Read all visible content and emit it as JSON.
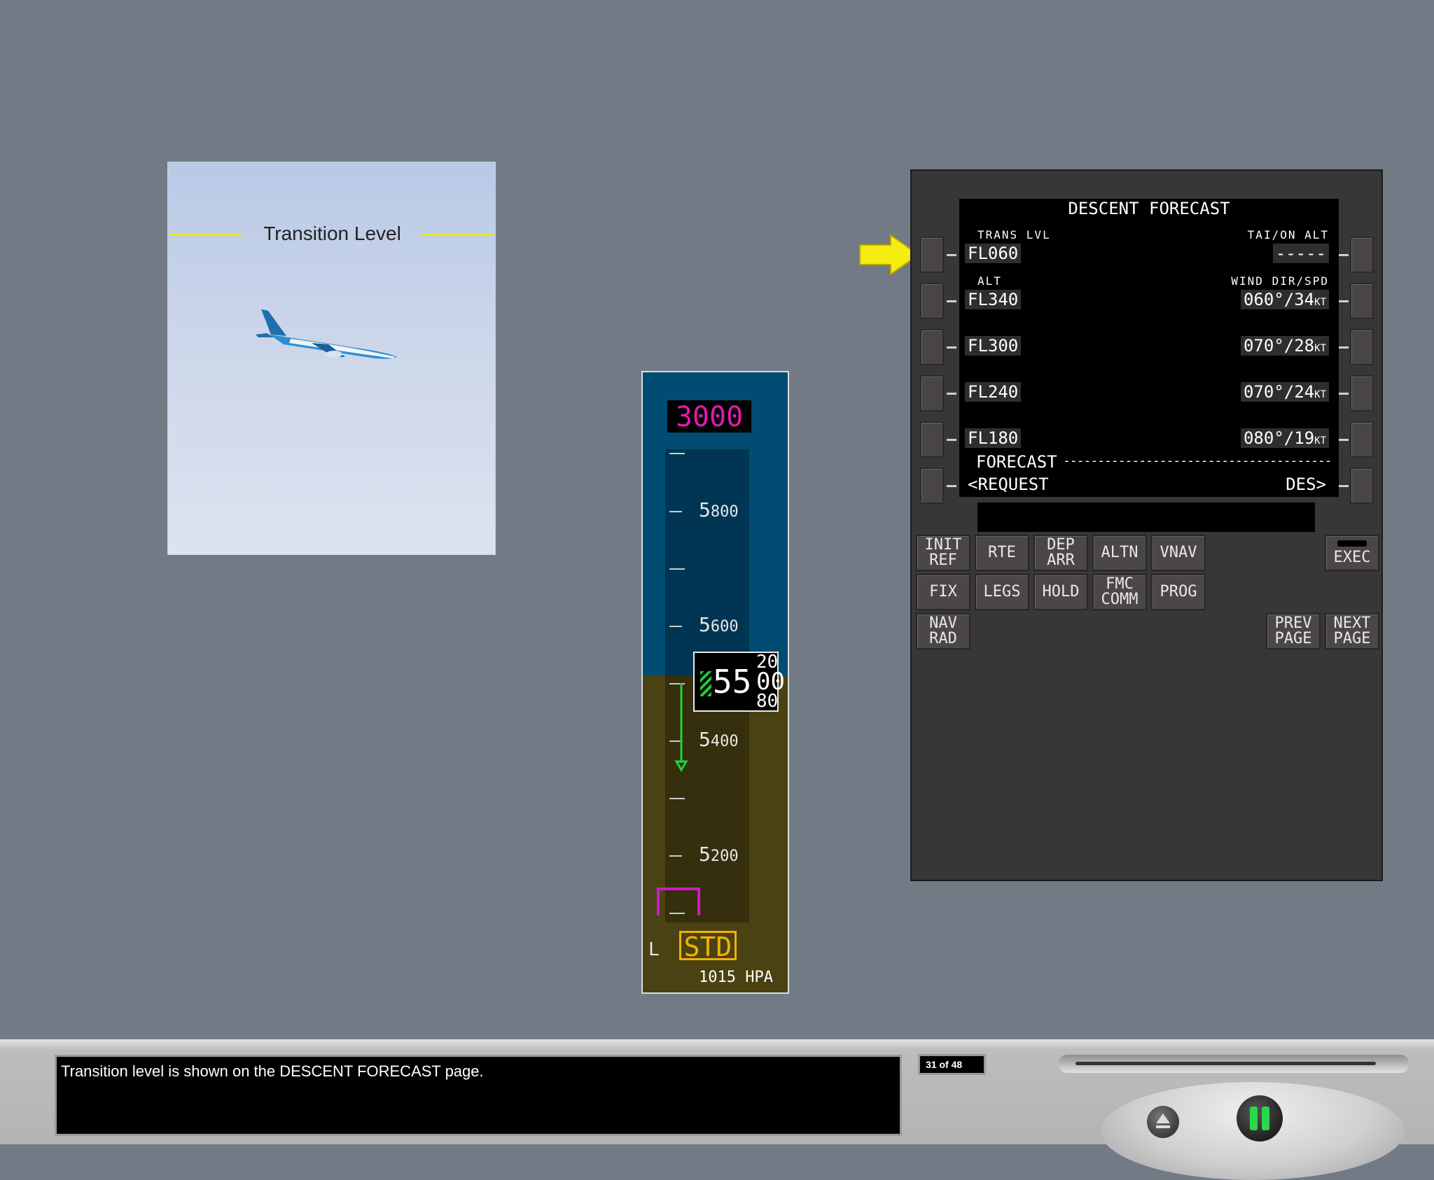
{
  "picture": {
    "label": "Transition Level",
    "line_color": "#e6ec14"
  },
  "altimeter": {
    "selected_altitude": "3000",
    "scale_labels": [
      {
        "big": "5",
        "small": "800"
      },
      {
        "big": "5",
        "small": "600"
      },
      {
        "big": "5",
        "small": "400"
      },
      {
        "big": "5",
        "small": "200"
      }
    ],
    "current_altitude": "55",
    "current_roll_top": "20",
    "current_roll_mid": "00",
    "current_roll_bottom": "80",
    "baro_side": "L",
    "baro_mode": "STD",
    "baro_setting": "1015 HPA"
  },
  "cdu": {
    "title": "DESCENT FORECAST",
    "left_labels": [
      "TRANS LVL",
      "ALT",
      "",
      "",
      "",
      "FORECAST"
    ],
    "right_labels": [
      "TAI/ON ALT",
      "WIND DIR/SPD",
      "",
      "",
      "",
      ""
    ],
    "left_values": [
      "FL060",
      "FL340",
      "FL300",
      "FL240",
      "FL180",
      "<REQUEST"
    ],
    "right_values": [
      "-----",
      "060°/34",
      "070°/28",
      "070°/24",
      "080°/19",
      "DES>"
    ],
    "wind_unit": "KT",
    "forecast_dashes": "---------------------------------------",
    "keys_row1": [
      "INIT\nREF",
      "RTE",
      "DEP\nARR",
      "ALTN",
      "VNAV"
    ],
    "keys_row2": [
      "FIX",
      "LEGS",
      "HOLD",
      "FMC\nCOMM",
      "PROG"
    ],
    "keys_row3": [
      "NAV\nRAD"
    ],
    "exec_label": "EXEC",
    "prev_label": "PREV\nPAGE",
    "next_label": "NEXT\nPAGE"
  },
  "player": {
    "caption": "Transition level is shown on the DESCENT FORECAST page.",
    "page_counter": "31 of 48",
    "progress": 0.95,
    "play_color": "#2bd64a"
  }
}
